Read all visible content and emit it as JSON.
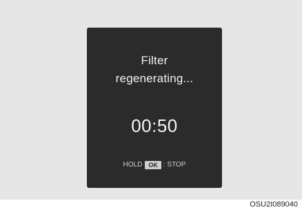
{
  "display": {
    "message_line1": "Filter",
    "message_line2": "regenerating...",
    "timer": "00:50",
    "hint": {
      "hold_label": "HOLD",
      "key_label": "OK",
      "stop_label": ": STOP"
    }
  },
  "figure_code": "OSU2I089040",
  "colors": {
    "frame_background": "#e6e6e6",
    "display_background": "#2b2b2b",
    "text": "#f2f2f2"
  }
}
